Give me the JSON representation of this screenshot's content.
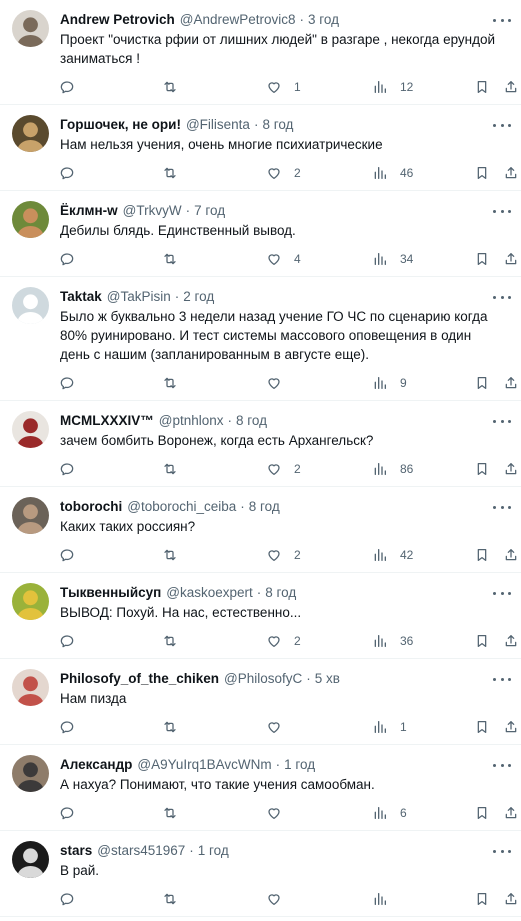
{
  "tweets": [
    {
      "name": "Andrew Petrovich",
      "handle": "@AndrewPetrovic8",
      "time": "3 год",
      "text": "Проект \"очистка рфии от лишних людей\" в разгаре , некогда ерундой заниматься !",
      "likes": "1",
      "views": "12",
      "avatar_colors": [
        "#d9d4cd",
        "#7a6a5a"
      ]
    },
    {
      "name": "Горшочек, не ори!",
      "handle": "@Filisenta",
      "time": "8 год",
      "text": "Нам нельзя учения, очень многие психиатрические",
      "likes": "2",
      "views": "46",
      "avatar_colors": [
        "#5a4a2e",
        "#c8a26a"
      ]
    },
    {
      "name": "Ёклмн-w",
      "handle": "@TrkvyW",
      "time": "7 год",
      "text": "Дебилы блядь. Единственный вывод.",
      "likes": "4",
      "views": "34",
      "avatar_colors": [
        "#6e8a3a",
        "#c98f5c"
      ]
    },
    {
      "name": "Taktak",
      "handle": "@TakPisin",
      "time": "2 год",
      "text": "Было ж буквально 3 недели назад учение ГО ЧС по сценарию когда 80% руинировано. И тест системы массового оповещения в один день с нашим (запланированным в августе еще).",
      "likes": "",
      "views": "9",
      "avatar_colors": [
        "#cfd9de",
        "#ffffff"
      ]
    },
    {
      "name": "MCMLXXXIV™",
      "handle": "@ptnhlonx",
      "time": "8 год",
      "text": "зачем бомбить Воронеж, когда есть Архангельск?",
      "likes": "2",
      "views": "86",
      "avatar_colors": [
        "#e9e5e0",
        "#9a2a2a"
      ]
    },
    {
      "name": "toborochi",
      "handle": "@toborochi_ceiba",
      "time": "8 год",
      "text": "Каких таких россиян?",
      "likes": "2",
      "views": "42",
      "avatar_colors": [
        "#6b6258",
        "#b89a80"
      ]
    },
    {
      "name": "Тыквенныйсуп",
      "handle": "@kaskoexpert",
      "time": "8 год",
      "text": "ВЫВОД: Похуй. На нас, естественно...",
      "likes": "2",
      "views": "36",
      "avatar_colors": [
        "#9ab23a",
        "#e2c23c"
      ]
    },
    {
      "name": "Philosofy_of_the_chiken",
      "handle": "@PhilosofyC",
      "time": "5 хв",
      "text": "Нам пизда",
      "likes": "",
      "views": "1",
      "avatar_colors": [
        "#e4d7cf",
        "#c2524a"
      ]
    },
    {
      "name": "Александр",
      "handle": "@A9YuIrq1BAvcWNm",
      "time": "1 год",
      "text": "А нахуа? Понимают, что такие учения самообман.",
      "likes": "",
      "views": "6",
      "avatar_colors": [
        "#8e7c6a",
        "#3c3a3a"
      ]
    },
    {
      "name": "stars",
      "handle": "@stars451967",
      "time": "1 год",
      "text": "В рай.",
      "likes": "",
      "views": "",
      "avatar_colors": [
        "#1b1b1b",
        "#d9d9d9"
      ]
    }
  ]
}
